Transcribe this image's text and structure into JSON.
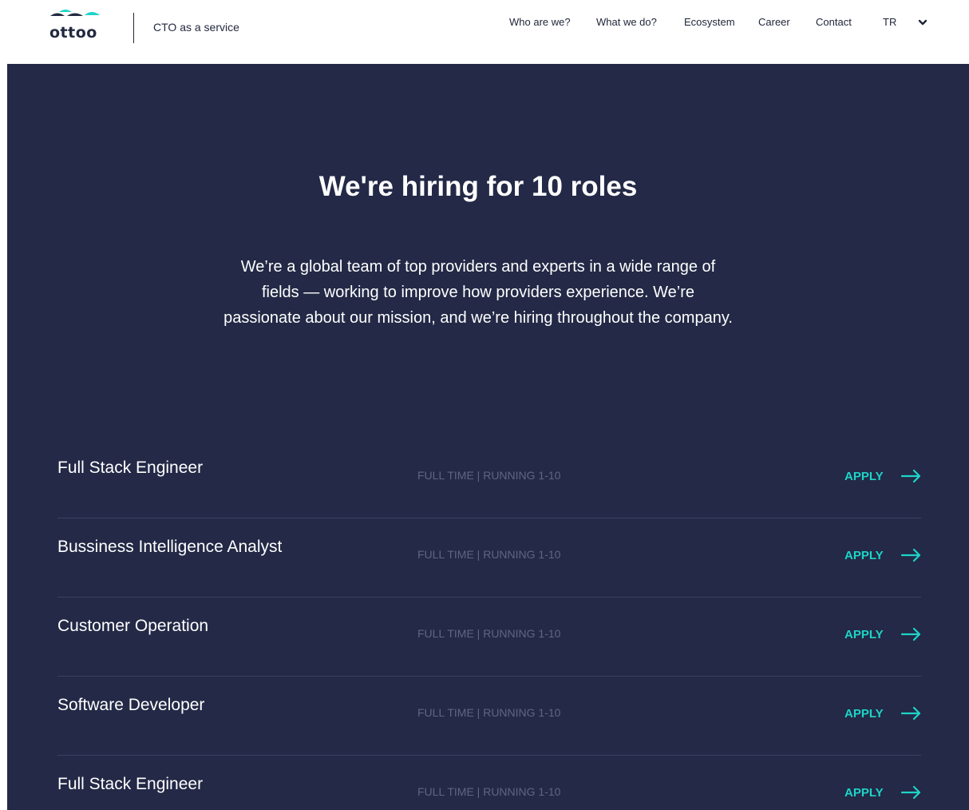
{
  "header": {
    "logo_text": "ottoo",
    "tagline": "CTO as a service",
    "nav": [
      {
        "label": "Who are we?",
        "name": "nav-who-are-we"
      },
      {
        "label": "What we do?",
        "name": "nav-what-we-do"
      },
      {
        "label": "Ecosystem",
        "name": "nav-ecosystem"
      },
      {
        "label": "Career",
        "name": "nav-career"
      },
      {
        "label": "Contact",
        "name": "nav-contact"
      }
    ],
    "language": "TR",
    "language_icon": "chevron-down-icon"
  },
  "hero": {
    "title": "We're hiring for 10 roles",
    "text": "We’re a global team of top providers and experts in a wide range of fields — working to improve how providers experience. We’re passionate about our mission, and we’re hiring throughout the company."
  },
  "jobs": [
    {
      "title": "Full Stack Engineer",
      "meta": "FULL TIME | RUNNING 1-10",
      "apply": "APPLY"
    },
    {
      "title": "Bussiness Intelligence Analyst",
      "meta": "FULL TIME | RUNNING 1-10",
      "apply": "APPLY"
    },
    {
      "title": "Customer Operation",
      "meta": "FULL TIME | RUNNING 1-10",
      "apply": "APPLY"
    },
    {
      "title": "Software Developer",
      "meta": "FULL TIME | RUNNING 1-10",
      "apply": "APPLY"
    },
    {
      "title": "Full Stack Engineer",
      "meta": "FULL TIME | RUNNING 1-10",
      "apply": "APPLY"
    }
  ],
  "colors": {
    "background": "#232946",
    "accent": "#1ed4c8",
    "text_dark": "#23293f",
    "meta_text": "#5e6683"
  }
}
